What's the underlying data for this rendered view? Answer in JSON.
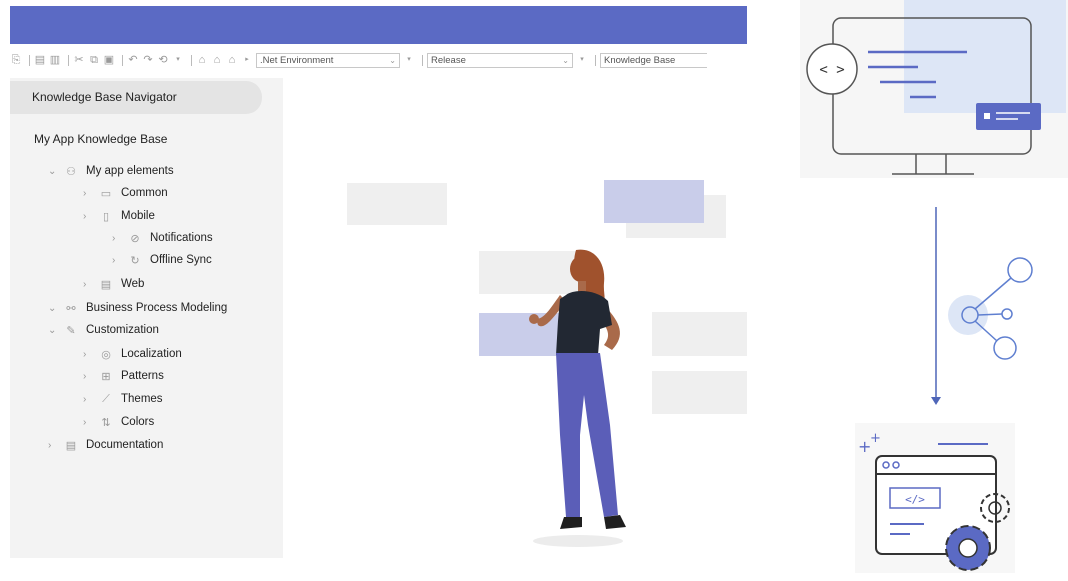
{
  "toolbar": {
    "environment": ".Net Environment",
    "configuration": "Release",
    "knowledge_base": "Knowledge Base"
  },
  "navigator": {
    "title": "Knowledge Base Navigator",
    "kb_title": "My App Knowledge Base",
    "items": [
      {
        "label": "My app elements",
        "icon": "app-elements-icon"
      },
      {
        "label": "Common",
        "icon": "folder-icon"
      },
      {
        "label": "Mobile",
        "icon": "mobile-icon"
      },
      {
        "label": "Notifications",
        "icon": "check-circle-icon"
      },
      {
        "label": "Offline Sync",
        "icon": "sync-icon"
      },
      {
        "label": "Web",
        "icon": "web-icon"
      },
      {
        "label": "Business Process Modeling",
        "icon": "process-icon"
      },
      {
        "label": "Customization",
        "icon": "pencil-icon"
      },
      {
        "label": "Localization",
        "icon": "location-icon"
      },
      {
        "label": "Patterns",
        "icon": "grid-icon"
      },
      {
        "label": "Themes",
        "icon": "brush-icon"
      },
      {
        "label": "Colors",
        "icon": "color-sliders-icon"
      },
      {
        "label": "Documentation",
        "icon": "document-icon"
      }
    ]
  },
  "illustrations": {
    "code_symbol": "< >"
  },
  "colors": {
    "accent": "#5b6ac4",
    "light_accent": "#c9cdea",
    "panel": "#f3f3f3"
  }
}
